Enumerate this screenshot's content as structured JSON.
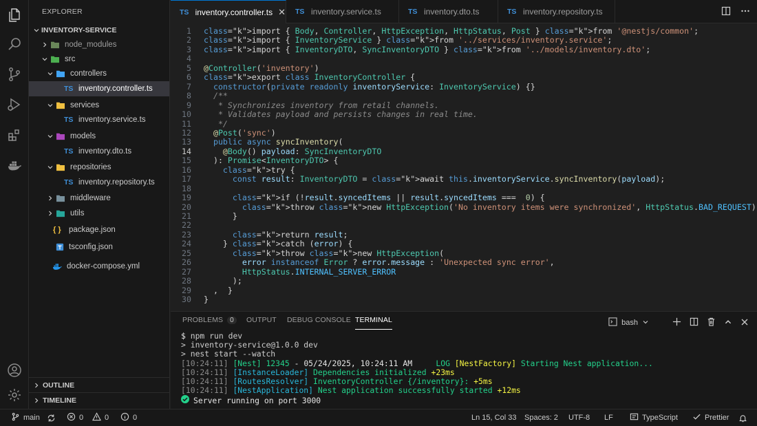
{
  "activity_bar": {
    "icons": [
      "files-icon",
      "search-icon",
      "source-control-icon",
      "run-debug-icon",
      "extensions-icon",
      "docker-icon"
    ],
    "bottom_icons": [
      "account-icon",
      "settings-gear-icon"
    ]
  },
  "sidebar": {
    "title": "EXPLORER",
    "project": "INVENTORY-SERVICE",
    "items": [
      {
        "label": "node_modules",
        "type": "folder"
      },
      {
        "label": "src",
        "type": "folder"
      },
      {
        "label": "controllers",
        "type": "folder"
      },
      {
        "label": "inventory.controller.ts",
        "type": "ts-file",
        "badge": "TS"
      },
      {
        "label": "services",
        "type": "folder"
      },
      {
        "label": "inventory.service.ts",
        "type": "ts-file",
        "badge": "TS"
      },
      {
        "label": "models",
        "type": "folder"
      },
      {
        "label": "inventory.dto.ts",
        "type": "ts-file",
        "badge": "TS"
      },
      {
        "label": "repositories",
        "type": "folder"
      },
      {
        "label": "inventory.repository.ts",
        "type": "ts-file",
        "badge": "TS"
      },
      {
        "label": "middleware",
        "type": "folder"
      },
      {
        "label": "utils",
        "type": "folder"
      },
      {
        "label": "package.json",
        "type": "json-file",
        "badge": "{ }"
      },
      {
        "label": "tsconfig.json",
        "type": "json-file"
      },
      {
        "label": "docker-compose.yml",
        "type": "docker-file"
      }
    ],
    "sections": [
      "OUTLINE",
      "TIMELINE"
    ]
  },
  "tabs": [
    {
      "label": "inventory.controller.ts",
      "badge": "TS",
      "active": true
    },
    {
      "label": "inventory.service.ts",
      "badge": "TS"
    },
    {
      "label": "inventory.dto.ts",
      "badge": "TS"
    },
    {
      "label": "inventory.repository.ts",
      "badge": "TS"
    }
  ],
  "editor": {
    "current_line": 14,
    "lines": [
      "import { Body, Controller, HttpException, HttpStatus, Post } from '@nestjs/common';",
      "import { InventoryService } from '../services/inventory.service';",
      "import { InventoryDTO, SyncInventoryDTO } from '../models/inventory.dto';",
      "",
      "@Controller('inventory')",
      "export class InventoryController {",
      "  constructor(private readonly inventoryService: InventoryService) {}",
      "  /**",
      "   * Synchronizes inventory from retail channels.",
      "   * Validates payload and persists changes in real time.",
      "   */",
      "  @Post('sync')",
      "  public async syncInventory(",
      "    @Body() payload: SyncInventoryDTO",
      "  ): Promise<InventoryDTO> {",
      "    try {",
      "      const result: InventoryDTO = await this.inventoryService.syncInventory(payload);",
      "",
      "      if (!result.syncedItems || result.syncedItems ===  0) {",
      "        throw new HttpException('No inventory items were synchronized', HttpStatus.BAD_REQUEST);",
      "      }",
      "",
      "      return result;",
      "    } catch (error) {",
      "      throw new HttpException(",
      "        error instanceof Error ? error.message : 'Unexpected sync error',",
      "        HttpStatus.INTERNAL_SERVER_ERROR",
      "      );",
      "  ,  }",
      "}"
    ]
  },
  "panel": {
    "tabs": [
      {
        "label": "PROBLEMS",
        "badge": "0"
      },
      {
        "label": "OUTPUT"
      },
      {
        "label": "DEBUG CONSOLE"
      },
      {
        "label": "TERMINAL",
        "active": true
      }
    ],
    "shell": "bash",
    "terminal": {
      "cmd_prompt": "$",
      "cmd": "npm run dev",
      "line2": "> inventory-service@1.0.0 dev",
      "line3": "> nest start --watch",
      "logs": [
        {
          "time": "[10:24:11]",
          "tag": "[Nest]",
          "pid": "12345",
          "rest": " - 05/24/2025, 10:24:11 AM",
          "level": "LOG",
          "ctx": "[NestFactory]",
          "msg": "Starting Nest application...",
          "dur": ""
        },
        {
          "time": "[10:24:11]",
          "tag": "[InstanceLoader]",
          "msg": "Dependencies initialized",
          "dur": "+23ms"
        },
        {
          "time": "[10:24:11]",
          "tag": "[RoutesResolver]",
          "msg": "InventoryController {/inventory}:",
          "dur": "+5ms"
        },
        {
          "time": "[10:24:11]",
          "tag": "[NestApplication]",
          "msg": "Nest application successfully started",
          "dur": "+12ms"
        }
      ],
      "final": "Server running on port 3000"
    }
  },
  "statusbar": {
    "branch": "main",
    "errors": "0",
    "warnings": "0",
    "info": "0",
    "cursor": "Ln 15, Col 33",
    "spaces": "Spaces: 2",
    "encoding": "UTF-8",
    "eol": "LF",
    "language": "TypeScript",
    "formatter": "Prettier"
  }
}
